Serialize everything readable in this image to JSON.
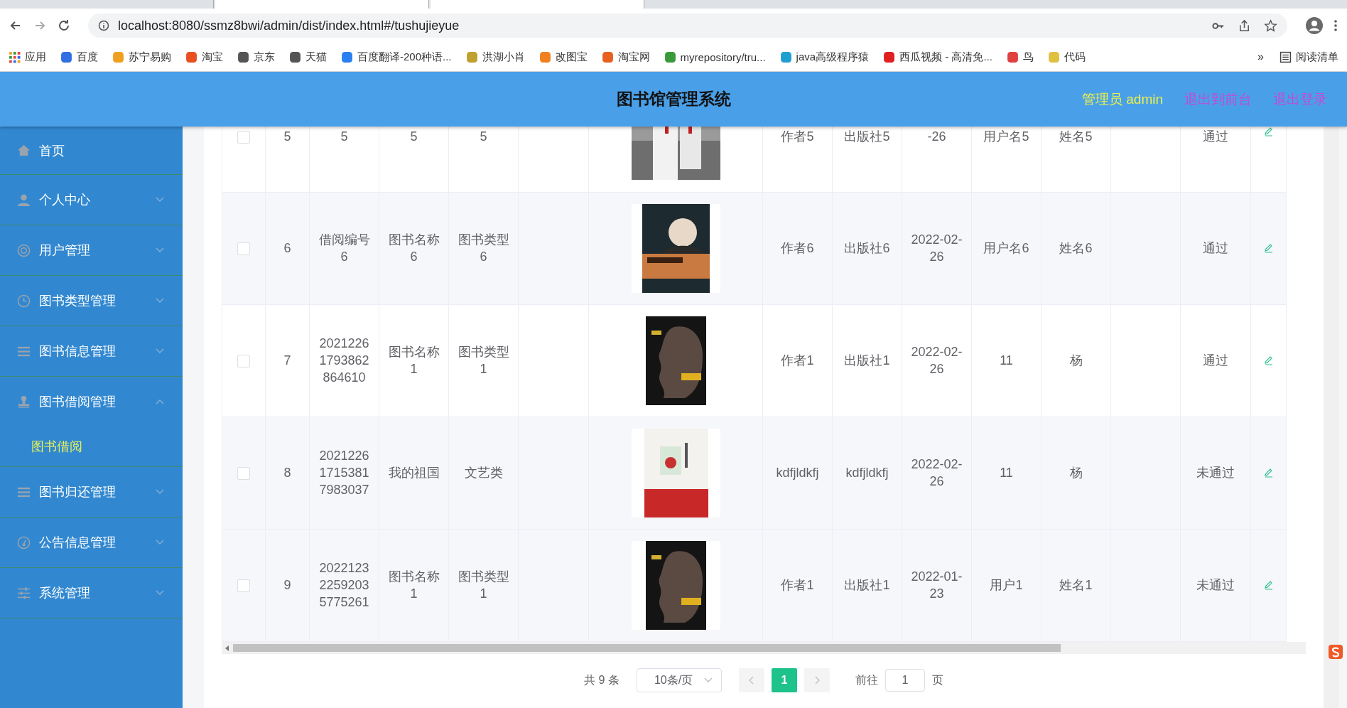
{
  "browser": {
    "address": "localhost:8080/ssmz8bwi/admin/dist/index.html#/tushujieyue",
    "bookmarks": [
      "应用",
      "百度",
      "苏宁易购",
      "淘宝",
      "京东",
      "天猫",
      "百度翻译-200种语...",
      "洪湖小肖",
      "改图宝",
      "淘宝网",
      "myrepository/tru...",
      "java高级程序猿",
      "西瓜视频 - 高清免...",
      "鸟",
      "代码"
    ],
    "more": "»",
    "reading_list": "阅读清单"
  },
  "header": {
    "title": "图书馆管理系统",
    "user": "管理员 admin",
    "links": [
      "退出到前台",
      "退出登录"
    ]
  },
  "sidebar": {
    "items": [
      {
        "label": "首页",
        "kind": "link"
      },
      {
        "label": "个人中心",
        "kind": "group",
        "expanded": false
      },
      {
        "label": "用户管理",
        "kind": "group",
        "expanded": false
      },
      {
        "label": "图书类型管理",
        "kind": "group",
        "expanded": false
      },
      {
        "label": "图书信息管理",
        "kind": "group",
        "expanded": false
      },
      {
        "label": "图书借阅管理",
        "kind": "group",
        "expanded": true,
        "children": [
          {
            "label": "图书借阅",
            "selected": true
          }
        ]
      },
      {
        "label": "图书归还管理",
        "kind": "group",
        "expanded": false
      },
      {
        "label": "公告信息管理",
        "kind": "group",
        "expanded": false
      },
      {
        "label": "系统管理",
        "kind": "group",
        "expanded": false
      }
    ]
  },
  "table": {
    "rows": [
      {
        "checked": false,
        "index": "5",
        "borrow_no": "5",
        "book_name": "5",
        "book_type": "5",
        "author": "作者5",
        "publisher": "出版社5",
        "date": "-26",
        "username": "用户名5",
        "name": "姓名5",
        "status": "通过"
      },
      {
        "checked": false,
        "index": "6",
        "borrow_no": "借阅编号6",
        "book_name": "图书名称6",
        "book_type": "图书类型6",
        "author": "作者6",
        "publisher": "出版社6",
        "date": "2022-02-26",
        "username": "用户名6",
        "name": "姓名6",
        "status": "通过"
      },
      {
        "checked": false,
        "index": "7",
        "borrow_no": "20212261793862864610",
        "book_name": "图书名称1",
        "book_type": "图书类型1",
        "author": "作者1",
        "publisher": "出版社1",
        "date": "2022-02-26",
        "username": "11",
        "name": "杨",
        "status": "通过"
      },
      {
        "checked": false,
        "index": "8",
        "borrow_no": "202122617153817983037",
        "book_name": "我的祖国",
        "book_type": "文艺类",
        "author": "kdfjldkfj",
        "publisher": "kdfjldkfj",
        "date": "2022-02-26",
        "username": "11",
        "name": "杨",
        "status": "未通过"
      },
      {
        "checked": false,
        "index": "9",
        "borrow_no": "202212322592035775261",
        "book_name": "图书名称1",
        "book_type": "图书类型1",
        "author": "作者1",
        "publisher": "出版社1",
        "date": "2022-01-23",
        "username": "用户1",
        "name": "姓名1",
        "status": "未通过"
      }
    ]
  },
  "pagination": {
    "total": "共 9 条",
    "page_size": "10条/页",
    "prev_disabled": true,
    "next_disabled": true,
    "pages": [
      {
        "label": "1",
        "selected": true
      }
    ],
    "goto_label": "前往",
    "goto_value": "1",
    "goto_suffix": "页"
  }
}
